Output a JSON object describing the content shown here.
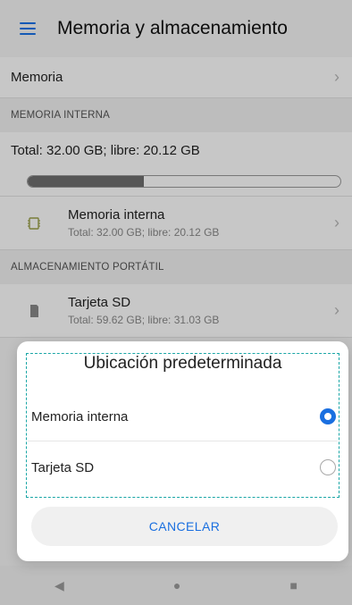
{
  "appbar": {
    "title": "Memoria y almacenamiento",
    "menu_icon": "hamburger-icon"
  },
  "memoria_row": {
    "label": "Memoria"
  },
  "internal_section": {
    "header": "MEMORIA INTERNA",
    "total_text": "Total: 32.00 GB; libre: 20.12 GB",
    "used_fraction": 0.37,
    "item": {
      "title": "Memoria interna",
      "subtitle": "Total: 32.00 GB; libre: 20.12 GB",
      "icon": "chip-icon"
    }
  },
  "portable_section": {
    "header": "ALMACENAMIENTO PORTÁTIL",
    "item": {
      "title": "Tarjeta SD",
      "subtitle": "Total: 59.62 GB; libre: 31.03 GB",
      "icon": "sd-card-icon"
    }
  },
  "dialog": {
    "title": "Ubicación predeterminada",
    "options": [
      {
        "label": "Memoria interna",
        "selected": true
      },
      {
        "label": "Tarjeta SD",
        "selected": false
      }
    ],
    "cancel_label": "CANCELAR"
  },
  "colors": {
    "accent": "#1a6fe0",
    "highlight": "#1aa6a6"
  }
}
